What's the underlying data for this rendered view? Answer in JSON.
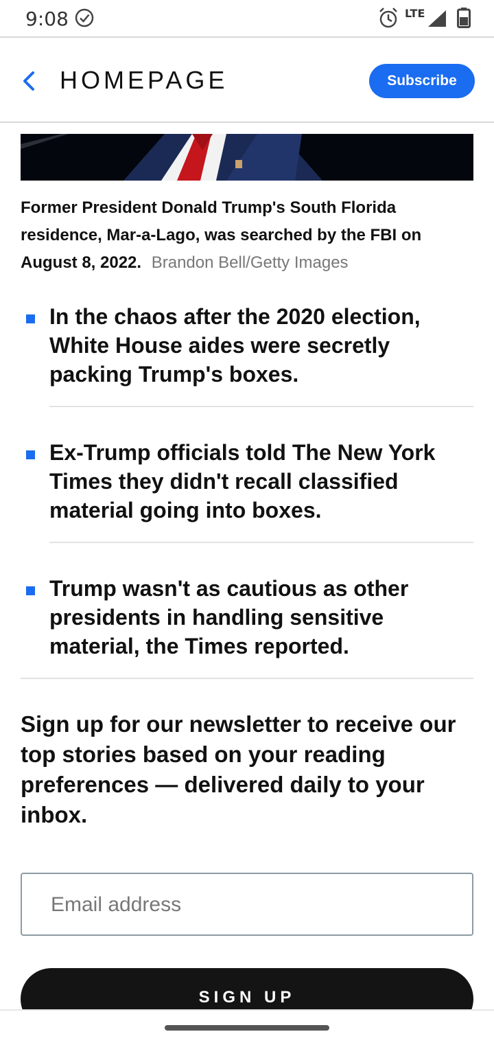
{
  "status_bar": {
    "time": "9:08",
    "network": "LTE",
    "icons": [
      "check-circle-icon",
      "alarm-icon",
      "signal-icon",
      "battery-icon"
    ]
  },
  "header": {
    "title": "HOMEPAGE",
    "subscribe_label": "Subscribe",
    "accent_color": "#1a6cf0"
  },
  "article": {
    "caption": "Former President Donald Trump's South Florida residence, Mar-a-Lago, was searched by the FBI on August 8, 2022.",
    "credit": "Brandon Bell/Getty Images",
    "bullets": [
      "In the chaos after the 2020 election, White House aides were secretly packing Trump's boxes.",
      "Ex-Trump officials told The New York Times they didn't recall classified material going into boxes.",
      "Trump wasn't as cautious as other presidents in handling sensitive material, the Times reported."
    ]
  },
  "newsletter": {
    "heading": "Sign up for our newsletter to receive our top stories based on your reading preferences — delivered daily to your inbox.",
    "email_placeholder": "Email address",
    "signup_label": "SIGN UP"
  }
}
